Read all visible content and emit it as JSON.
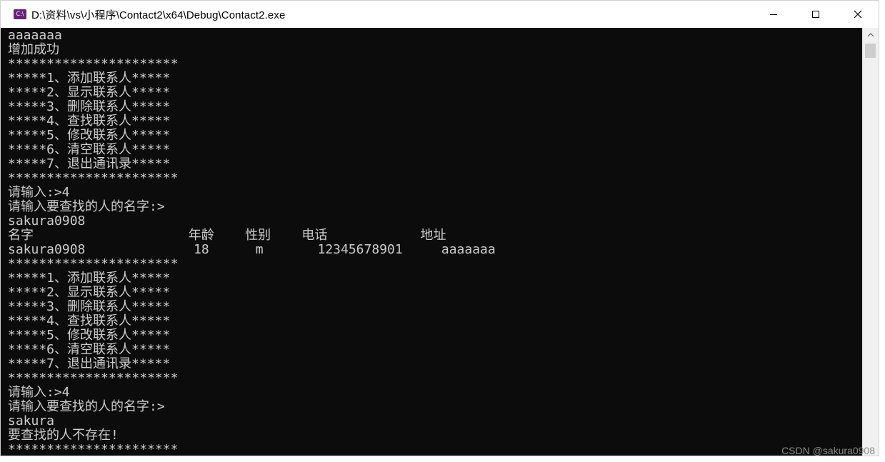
{
  "window": {
    "app_icon_label": "C:\\",
    "title": "D:\\资料\\vs\\小程序\\Contact2\\x64\\Debug\\Contact2.exe",
    "controls": {
      "minimize": "minimize-icon",
      "maximize": "maximize-icon",
      "close": "close-icon"
    }
  },
  "console": {
    "lines": [
      "aaaaaaa",
      "增加成功",
      "**********************",
      "*****1、添加联系人*****",
      "*****2、显示联系人*****",
      "*****3、删除联系人*****",
      "*****4、查找联系人*****",
      "*****5、修改联系人*****",
      "*****6、清空联系人*****",
      "*****7、退出通讯录*****",
      "**********************",
      "请输入:>4",
      "请输入要查找的人的名字:>",
      "sakura0908",
      "名字                    年龄    性别    电话            地址",
      "sakura0908              18      m       12345678901     aaaaaaa",
      "**********************",
      "*****1、添加联系人*****",
      "*****2、显示联系人*****",
      "*****3、删除联系人*****",
      "*****4、查找联系人*****",
      "*****5、修改联系人*****",
      "*****6、清空联系人*****",
      "*****7、退出通讯录*****",
      "**********************",
      "请输入:>4",
      "请输入要查找的人的名字:>",
      "sakura",
      "要查找的人不存在!",
      "**********************"
    ]
  },
  "watermark": "CSDN @sakura0908",
  "colors": {
    "console_bg": "#0c0c0c",
    "console_text": "#cccccc",
    "titlebar_bg": "#ffffff",
    "app_icon": "#68217a"
  }
}
